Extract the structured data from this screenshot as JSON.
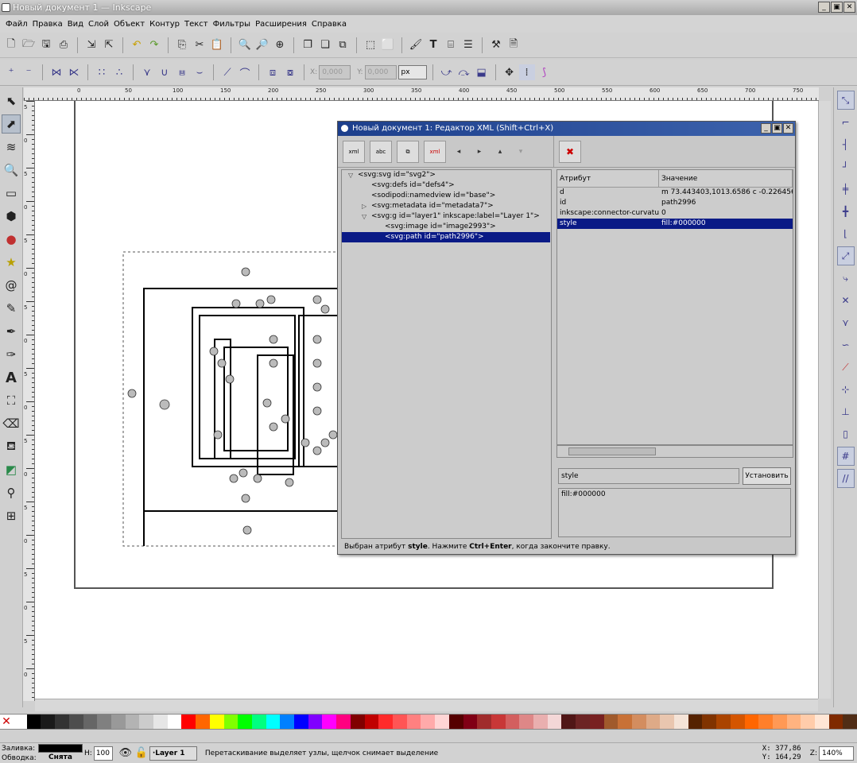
{
  "window": {
    "title": "Новый документ 1 — Inkscape",
    "min": "_",
    "max": "▣",
    "close": "✕"
  },
  "menu": [
    "Файл",
    "Правка",
    "Вид",
    "Слой",
    "Объект",
    "Контур",
    "Текст",
    "Фильтры",
    "Расширения",
    "Справка"
  ],
  "toolbar2": {
    "x_label": "X:",
    "x_value": "0,000",
    "y_label": "Y:",
    "y_value": "0,000",
    "unit": "px"
  },
  "ruler": {
    "h_ticks": [
      "0",
      "50",
      "100",
      "150",
      "200",
      "250",
      "300",
      "350",
      "400",
      "450",
      "500",
      "550",
      "600",
      "650",
      "700",
      "750"
    ],
    "v_ticks": [
      "5",
      "0",
      "5",
      "0",
      "5",
      "0",
      "5",
      "0",
      "5",
      "0",
      "5",
      "0",
      "5",
      "0",
      "5",
      "0",
      "5",
      "0"
    ]
  },
  "xml_editor": {
    "title": "Новый документ 1: Редактор XML (Shift+Ctrl+X)",
    "toolbar": {
      "new_element": "xml",
      "new_text": "abc",
      "duplicate": "⧉",
      "delete": "xml",
      "unindent": "◂",
      "indent": "▸",
      "raise": "▴",
      "lower": "▾",
      "delete_attr": "✖"
    },
    "tree": [
      {
        "text": "<svg:svg id=\"svg2\">",
        "indent": 0,
        "arrow": "▽"
      },
      {
        "text": "<svg:defs id=\"defs4\">",
        "indent": 1,
        "arrow": ""
      },
      {
        "text": "<sodipodi:namedview id=\"base\">",
        "indent": 1,
        "arrow": ""
      },
      {
        "text": "<svg:metadata id=\"metadata7\">",
        "indent": 1,
        "arrow": "▷"
      },
      {
        "text": "<svg:g id=\"layer1\" inkscape:label=\"Layer 1\">",
        "indent": 1,
        "arrow": "▽"
      },
      {
        "text": "<svg:image id=\"image2993\">",
        "indent": 2,
        "arrow": ""
      },
      {
        "text": "<svg:path id=\"path2996\">",
        "indent": 2,
        "arrow": "",
        "selected": true
      }
    ],
    "attr_header": {
      "name": "Атрибут",
      "value": "Значение"
    },
    "attributes": [
      {
        "name": "d",
        "value": "m 73.443403,1013.6586 c -0.226456,-0."
      },
      {
        "name": "id",
        "value": "path2996"
      },
      {
        "name": "inkscape:connector-curvature",
        "value": "0"
      },
      {
        "name": "style",
        "value": "fill:#000000",
        "selected": true
      }
    ],
    "attr_name_field": "style",
    "set_button": "Установить",
    "attr_value_field": "fill:#000000",
    "status_pre": "Выбран атрибут ",
    "status_bold1": "style",
    "status_mid": ". Нажмите ",
    "status_bold2": "Ctrl+Enter",
    "status_post": ", когда закончите правку."
  },
  "palette": [
    "#ffffff",
    "#000000",
    "#1a1a1a",
    "#333333",
    "#4d4d4d",
    "#666666",
    "#808080",
    "#999999",
    "#b3b3b3",
    "#cccccc",
    "#e6e6e6",
    "#ffffff",
    "#ff0000",
    "#ff6600",
    "#ffff00",
    "#80ff00",
    "#00ff00",
    "#00ff80",
    "#00ffff",
    "#0080ff",
    "#0000ff",
    "#8000ff",
    "#ff00ff",
    "#ff0080",
    "#800000",
    "#c00000",
    "#ff2a2a",
    "#ff5555",
    "#ff8080",
    "#ffaaaa",
    "#ffd5d5",
    "#550000",
    "#800015",
    "#a02c2c",
    "#c83737",
    "#d35f5f",
    "#de8787",
    "#e9afaf",
    "#f4d7d7",
    "#501616",
    "#6c2424",
    "#782121",
    "#a05a2c",
    "#c87137",
    "#d38d5f",
    "#deaa87",
    "#e9c6af",
    "#f4e3d7",
    "#552200",
    "#803300",
    "#aa4400",
    "#d45500",
    "#ff6600",
    "#ff7f2a",
    "#ff9955",
    "#ffb380",
    "#ffccaa",
    "#ffe6d5",
    "#7f2a00",
    "#502d16"
  ],
  "status": {
    "fill_label": "Заливка:",
    "stroke_label": "Обводка:",
    "stroke_value": "Снята",
    "h_label": "H:",
    "h_value": "100",
    "layer": "·Layer 1",
    "message": "Перетаскивание выделяет узлы, щелчок снимает выделение",
    "x_label": "X:",
    "x_value": "377,86",
    "y_label": "Y:",
    "y_value": "164,29",
    "z_label": "Z:",
    "zoom": "140%"
  },
  "colors": {
    "selection": "#0a1a86",
    "dialog_title": "#1d3f8c",
    "snap_icons": "#3a3a8a"
  }
}
